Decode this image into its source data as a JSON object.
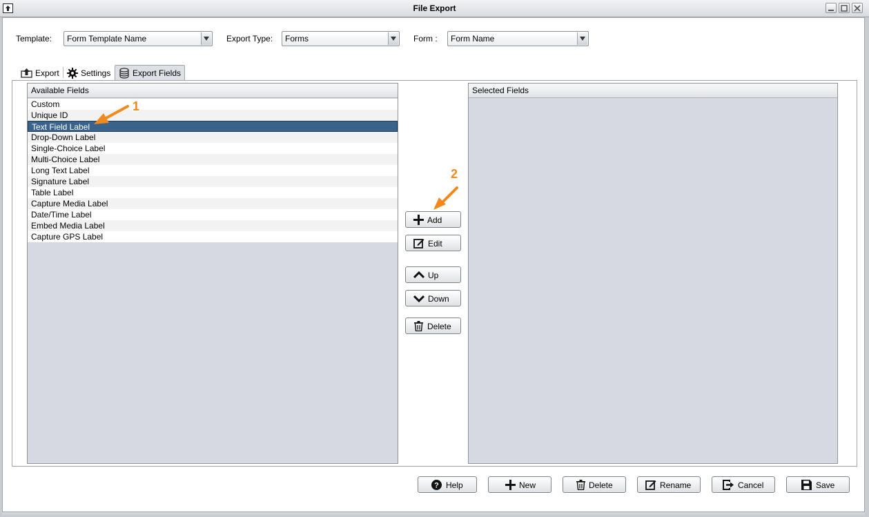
{
  "window": {
    "title": "File Export"
  },
  "top_fields": {
    "template_label": "Template:",
    "template_value": "Form Template Name",
    "export_type_label": "Export Type:",
    "export_type_value": "Forms",
    "form_label": "Form :",
    "form_value": "Form Name"
  },
  "tabs": [
    {
      "label": "Export",
      "icon": "upload-icon"
    },
    {
      "label": "Settings",
      "icon": "gear-icon"
    },
    {
      "label": "Export Fields",
      "icon": "database-icon",
      "active": true
    }
  ],
  "available_fields": {
    "header": "Available Fields",
    "items": [
      "Custom",
      "Unique ID",
      "Text Field Label",
      "Drop-Down Label",
      "Single-Choice Label",
      "Multi-Choice Label",
      "Long Text Label",
      "Signature Label",
      "Table Label",
      "Capture Media Label",
      "Date/Time Label",
      "Embed Media Label",
      "Capture GPS Label"
    ],
    "selected_index": 2
  },
  "selected_fields": {
    "header": "Selected Fields",
    "items": []
  },
  "middle_buttons": {
    "add": "Add",
    "edit": "Edit",
    "up": "Up",
    "down": "Down",
    "delete": "Delete"
  },
  "bottom_buttons": {
    "help": "Help",
    "new": "New",
    "delete": "Delete",
    "rename": "Rename",
    "cancel": "Cancel",
    "save": "Save"
  },
  "callouts": [
    "1",
    "2"
  ],
  "colors": {
    "selection": "#39638a",
    "callout": "#f08a1c",
    "list_background": "#d6d9df"
  }
}
